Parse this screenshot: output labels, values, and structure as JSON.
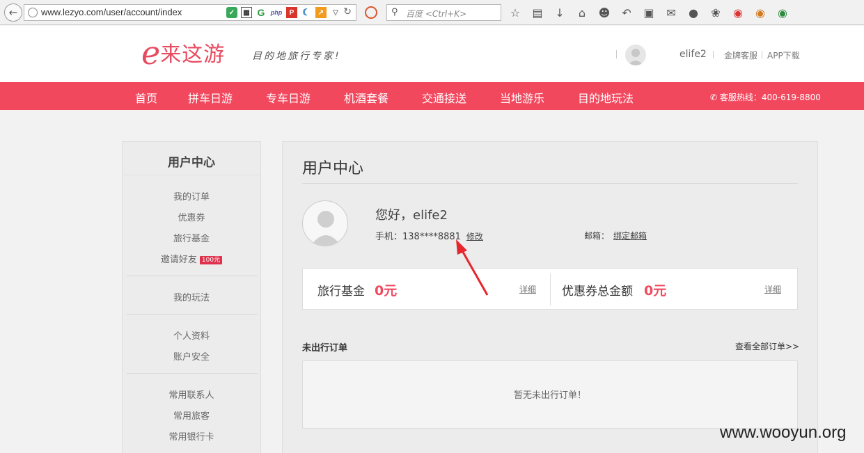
{
  "browser": {
    "url": "www.lezyo.com/user/account/index",
    "search_placeholder": "百度 <Ctrl+K>"
  },
  "header": {
    "logo_mark": "e",
    "logo_text": "来这游",
    "slogan": "目的地旅行专家!",
    "username": "elife2",
    "links": [
      "金牌客服",
      "APP下载"
    ]
  },
  "nav": {
    "items": [
      "首页",
      "拼车日游",
      "专车日游",
      "机酒套餐",
      "交通接送",
      "当地游乐",
      "目的地玩法"
    ],
    "hotline": "客服热线：400-619-8800"
  },
  "sidebar": {
    "title": "用户中心",
    "groups": [
      [
        "我的订单",
        "优惠券",
        "旅行基金",
        "邀请好友"
      ],
      [
        "我的玩法"
      ],
      [
        "个人资料",
        "账户安全"
      ],
      [
        "常用联系人",
        "常用旅客",
        "常用银行卡"
      ]
    ],
    "invite_badge": "100元"
  },
  "main": {
    "title": "用户中心",
    "greeting": "您好，elife2",
    "phone_label": "手机：",
    "phone": "138****8881",
    "edit": "修改",
    "email_label": "邮箱：",
    "bind_email": "绑定邮箱",
    "fund_label": "旅行基金",
    "fund_value": "0元",
    "coupon_label": "优惠券总金额",
    "coupon_value": "0元",
    "detail": "详细",
    "orders_title": "未出行订单",
    "orders_all": "查看全部订单>>",
    "orders_empty": "暂无未出行订单！"
  },
  "colors": {
    "brand": "#f2485e",
    "accent_red": "#ef4a5f"
  },
  "watermark": "www.wooyun.org"
}
